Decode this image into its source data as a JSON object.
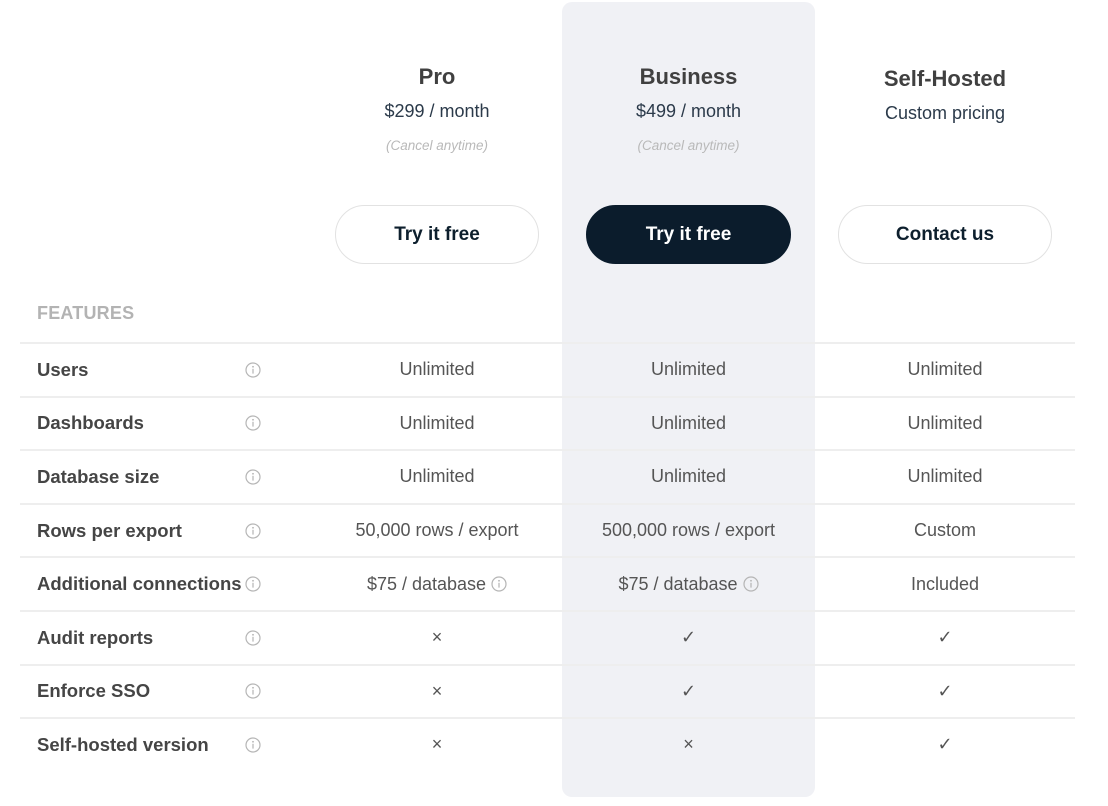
{
  "plans": [
    {
      "name": "Pro",
      "price": "$299 / month",
      "note": "(Cancel anytime)",
      "cta": "Try it free",
      "highlighted": false
    },
    {
      "name": "Business",
      "price": "$499 / month",
      "note": "(Cancel anytime)",
      "cta": "Try it free",
      "highlighted": true
    },
    {
      "name": "Self-Hosted",
      "price": "Custom pricing",
      "note": "",
      "cta": "Contact us",
      "highlighted": false
    }
  ],
  "features_heading": "FEATURES",
  "features": [
    {
      "label": "Users",
      "info_icon": "info-icon",
      "values": [
        "Unlimited",
        "Unlimited",
        "Unlimited"
      ]
    },
    {
      "label": "Dashboards",
      "info_icon": "info-icon",
      "values": [
        "Unlimited",
        "Unlimited",
        "Unlimited"
      ]
    },
    {
      "label": "Database size",
      "info_icon": "info-icon",
      "values": [
        "Unlimited",
        "Unlimited",
        "Unlimited"
      ]
    },
    {
      "label": "Rows per export",
      "info_icon": "info-icon",
      "values": [
        "50,000 rows / export",
        "500,000 rows / export",
        "Custom"
      ]
    },
    {
      "label": "Additional connections",
      "info_icon": "info-icon",
      "values": [
        "$75 / database",
        "$75 / database",
        "Included"
      ],
      "value_info": [
        true,
        true,
        false
      ]
    },
    {
      "label": "Audit reports",
      "info_icon": "info-icon",
      "values": [
        "×",
        "✓",
        "✓"
      ]
    },
    {
      "label": "Enforce SSO",
      "info_icon": "info-icon",
      "values": [
        "×",
        "✓",
        "✓"
      ]
    },
    {
      "label": "Self-hosted version",
      "info_icon": "info-icon",
      "values": [
        "×",
        "×",
        "✓"
      ]
    }
  ],
  "colors": {
    "primary_button": "#0b1c2c",
    "highlight_column": "#f0f1f5",
    "muted_text": "#b3b3b3"
  }
}
